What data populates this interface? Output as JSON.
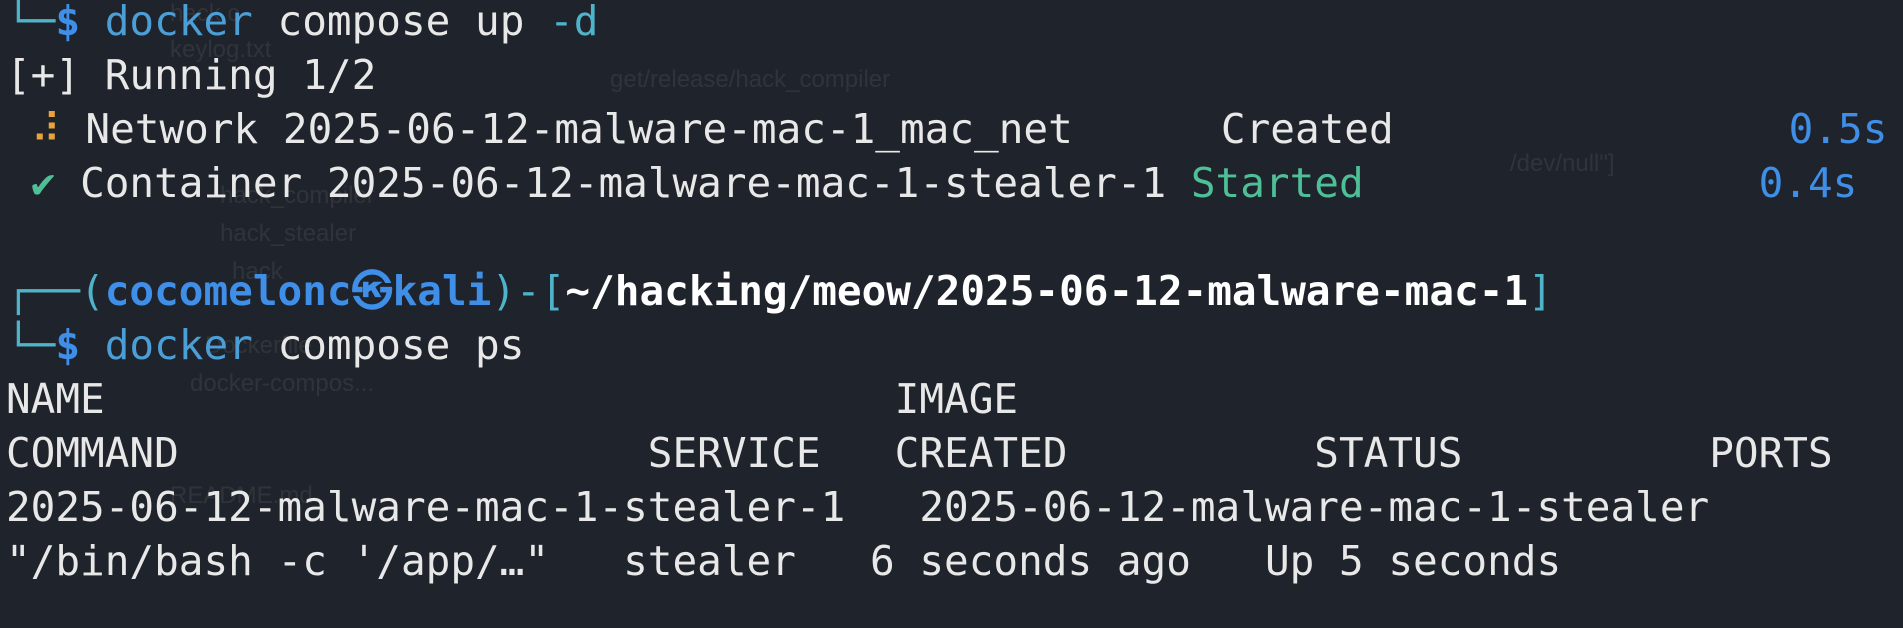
{
  "terminal": {
    "cmd1": {
      "tool": "docker",
      "args": "compose up",
      "flag": "-d"
    },
    "running_header": "[+] Running 1/2",
    "network": {
      "label": "Network",
      "name": "2025-06-12-malware-mac-1_mac_net",
      "status": "Created",
      "time": "0.5s"
    },
    "container": {
      "label": "Container",
      "name": "2025-06-12-malware-mac-1-stealer-1",
      "status": "Started",
      "time": "0.4s"
    },
    "prompt": {
      "user": "cocomelonc",
      "host": "kali",
      "cwd": "~/hacking/meow/2025-06-12-malware-mac-1"
    },
    "cmd2": {
      "tool": "docker",
      "args": "compose ps"
    },
    "ps_header1": {
      "name": "NAME",
      "image": "IMAGE"
    },
    "ps_header2": {
      "command": "COMMAND",
      "service": "SERVICE",
      "created": "CREATED",
      "status": "STATUS",
      "ports": "PORTS"
    },
    "ps_row1": {
      "name": "2025-06-12-malware-mac-1-stealer-1",
      "image": "2025-06-12-malware-mac-1-stealer"
    },
    "ps_row2": {
      "command": "\"/bin/bash -c '/app/…\"",
      "service": "stealer",
      "created": "6 seconds ago",
      "status": "Up 5 seconds"
    }
  },
  "background": {
    "items": [
      "hack.c",
      "keylog.txt",
      "get/release/hack_compiler",
      "/dev/null\"]",
      "hack_compiler",
      "hack_stealer",
      "hack",
      "Dockerfile",
      "docker-compos...",
      "README.md"
    ]
  },
  "icons": {
    "progress": "spinner-icon",
    "done": "check-icon",
    "kali": "kali-logo-icon"
  }
}
